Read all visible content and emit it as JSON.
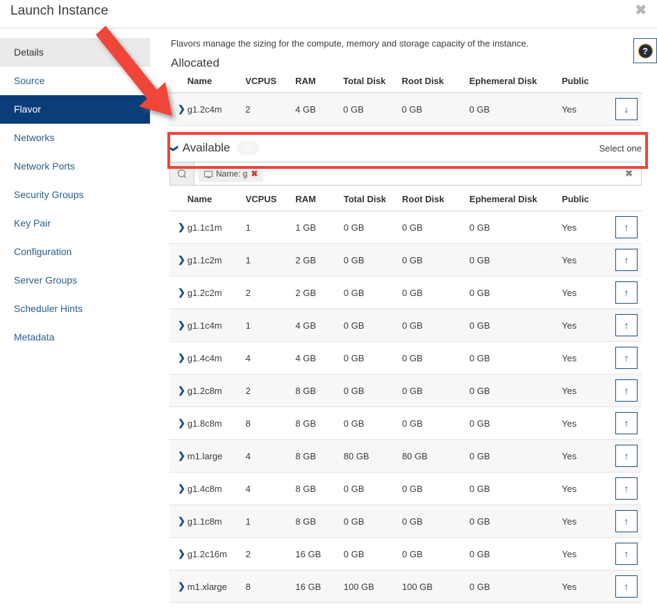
{
  "window": {
    "title": "Launch Instance",
    "close_label": "✖"
  },
  "sidebar": {
    "items": [
      {
        "label": "Details",
        "state": "hovered"
      },
      {
        "label": "Source",
        "state": "normal"
      },
      {
        "label": "Flavor",
        "state": "active"
      },
      {
        "label": "Networks",
        "state": "normal"
      },
      {
        "label": "Network Ports",
        "state": "normal"
      },
      {
        "label": "Security Groups",
        "state": "normal"
      },
      {
        "label": "Key Pair",
        "state": "normal"
      },
      {
        "label": "Configuration",
        "state": "normal"
      },
      {
        "label": "Server Groups",
        "state": "normal"
      },
      {
        "label": "Scheduler Hints",
        "state": "normal"
      },
      {
        "label": "Metadata",
        "state": "normal"
      }
    ]
  },
  "main": {
    "description": "Flavors manage the sizing for the compute, memory and storage capacity of the instance.",
    "help_glyph": "?",
    "allocated": {
      "title": "Allocated",
      "columns": [
        "Name",
        "VCPUS",
        "RAM",
        "Total Disk",
        "Root Disk",
        "Ephemeral Disk",
        "Public"
      ],
      "rows": [
        {
          "expand": "❯",
          "name": "g1.2c4m",
          "vcpus": "2",
          "ram": "4 GB",
          "total_disk": "0 GB",
          "root_disk": "0 GB",
          "ephemeral_disk": "0 GB",
          "public": "Yes",
          "action": "↓"
        }
      ]
    },
    "available": {
      "title": "Available",
      "caret": "❯",
      "count": "43",
      "select_hint": "Select one",
      "filter": {
        "search_icon": "search-icon",
        "chip_icon": "monitor-icon",
        "chip_label": "Name: g",
        "chip_remove": "✖",
        "clear_all": "✖",
        "input_value": "",
        "input_placeholder": ""
      },
      "columns": [
        "Name",
        "VCPUS",
        "RAM",
        "Total Disk",
        "Root Disk",
        "Ephemeral Disk",
        "Public"
      ],
      "rows": [
        {
          "expand": "❯",
          "name": "g1.1c1m",
          "vcpus": "1",
          "ram": "1 GB",
          "total_disk": "0 GB",
          "root_disk": "0 GB",
          "ephemeral_disk": "0 GB",
          "public": "Yes",
          "action": "↑"
        },
        {
          "expand": "❯",
          "name": "g1.1c2m",
          "vcpus": "1",
          "ram": "2 GB",
          "total_disk": "0 GB",
          "root_disk": "0 GB",
          "ephemeral_disk": "0 GB",
          "public": "Yes",
          "action": "↑"
        },
        {
          "expand": "❯",
          "name": "g1.2c2m",
          "vcpus": "2",
          "ram": "2 GB",
          "total_disk": "0 GB",
          "root_disk": "0 GB",
          "ephemeral_disk": "0 GB",
          "public": "Yes",
          "action": "↑"
        },
        {
          "expand": "❯",
          "name": "g1.1c4m",
          "vcpus": "1",
          "ram": "4 GB",
          "total_disk": "0 GB",
          "root_disk": "0 GB",
          "ephemeral_disk": "0 GB",
          "public": "Yes",
          "action": "↑"
        },
        {
          "expand": "❯",
          "name": "g1.4c4m",
          "vcpus": "4",
          "ram": "4 GB",
          "total_disk": "0 GB",
          "root_disk": "0 GB",
          "ephemeral_disk": "0 GB",
          "public": "Yes",
          "action": "↑"
        },
        {
          "expand": "❯",
          "name": "g1.2c8m",
          "vcpus": "2",
          "ram": "8 GB",
          "total_disk": "0 GB",
          "root_disk": "0 GB",
          "ephemeral_disk": "0 GB",
          "public": "Yes",
          "action": "↑"
        },
        {
          "expand": "❯",
          "name": "g1.8c8m",
          "vcpus": "8",
          "ram": "8 GB",
          "total_disk": "0 GB",
          "root_disk": "0 GB",
          "ephemeral_disk": "0 GB",
          "public": "Yes",
          "action": "↑"
        },
        {
          "expand": "❯",
          "name": "m1.large",
          "vcpus": "4",
          "ram": "8 GB",
          "total_disk": "80 GB",
          "root_disk": "80 GB",
          "ephemeral_disk": "0 GB",
          "public": "Yes",
          "action": "↑"
        },
        {
          "expand": "❯",
          "name": "g1.4c8m",
          "vcpus": "4",
          "ram": "8 GB",
          "total_disk": "0 GB",
          "root_disk": "0 GB",
          "ephemeral_disk": "0 GB",
          "public": "Yes",
          "action": "↑"
        },
        {
          "expand": "❯",
          "name": "g1.1c8m",
          "vcpus": "1",
          "ram": "8 GB",
          "total_disk": "0 GB",
          "root_disk": "0 GB",
          "ephemeral_disk": "0 GB",
          "public": "Yes",
          "action": "↑"
        },
        {
          "expand": "❯",
          "name": "g1.2c16m",
          "vcpus": "2",
          "ram": "16 GB",
          "total_disk": "0 GB",
          "root_disk": "0 GB",
          "ephemeral_disk": "0 GB",
          "public": "Yes",
          "action": "↑"
        },
        {
          "expand": "❯",
          "name": "m1.xlarge",
          "vcpus": "8",
          "ram": "16 GB",
          "total_disk": "100 GB",
          "root_disk": "100 GB",
          "ephemeral_disk": "0 GB",
          "public": "Yes",
          "action": "↑"
        }
      ]
    }
  },
  "annotation": {
    "arrow_color": "#f04438",
    "highlight_color": "#f04438"
  },
  "colors": {
    "active_nav": "#0b3d7a",
    "link": "#2a5d8f",
    "row_alt": "#f7f7f7"
  }
}
